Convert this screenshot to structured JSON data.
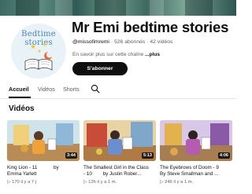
{
  "channel": {
    "name": "Mr Emi bedtime stories",
    "handle": "@missofimremi",
    "separator": "·",
    "subscribers": "526 abonnés",
    "videos_count": "42 vidéos",
    "description": "En savoir plus sur cette chaîne",
    "more": "...plus",
    "avatar_text": "Bedtime stories",
    "subscribe_label": "S'abonner"
  },
  "tabs": [
    {
      "label": "Accueil",
      "active": true
    },
    {
      "label": "Vidéos",
      "active": false
    },
    {
      "label": "Shorts",
      "active": false
    }
  ],
  "section_title": "Vidéos",
  "videos": [
    {
      "title_line1": "King Lion - 11",
      "by": "by",
      "title_line2": "Emma Yarlett",
      "duration": "3:44",
      "views": "170",
      "age": "il y a 7 j"
    },
    {
      "title_line1": "The Smallest Girl in the Class",
      "title_line2": "- 10",
      "by_author": "by Justin Rober...",
      "duration": "5:13",
      "views": "12h",
      "age": "il y a 1 m."
    },
    {
      "title_line1": "The Eyebrows of Doom - 9",
      "title_line2": "By Steve Smallman and ...",
      "duration": "4:06",
      "views": "246",
      "age": "il y a 1 m."
    }
  ],
  "colors": {
    "accent": "#0f0f0f",
    "muted": "#606060",
    "avatar_text": "#4a86b5"
  }
}
